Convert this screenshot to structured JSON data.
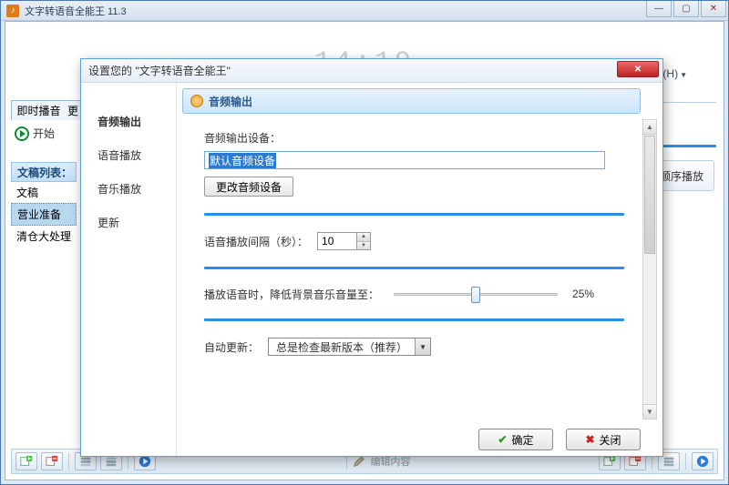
{
  "window": {
    "title": "文字转语音全能王 11.3",
    "clock": "14:19"
  },
  "menu_frag": {
    "help": "助(H)"
  },
  "left": {
    "tab_instant": "即时播音",
    "tab2_frag": "更",
    "start": "开始",
    "doclist_header": "文稿列表：",
    "items": [
      "文稿",
      "营业准备",
      "清仓大处理"
    ]
  },
  "right": {
    "seq_play": "顺序播放"
  },
  "toolbar": {
    "edit_placeholder": "编辑内容"
  },
  "dialog": {
    "title": "设置您的 \"文字转语音全能王\"",
    "nav": [
      "音频输出",
      "语音播放",
      "音乐播放",
      "更新"
    ],
    "section_title": "音频输出",
    "device_label": "音频输出设备：",
    "device_value": "默认音频设备",
    "change_device_btn": "更改音频设备",
    "interval_label": "语音播放间隔（秒）：",
    "interval_value": "10",
    "volume_label": "播放语音时，降低背景音乐音量至：",
    "volume_percent": "25%",
    "volume_pos": 0.5,
    "auto_update_label": "自动更新：",
    "auto_update_value": "总是检查最新版本（推荐）",
    "ok": "确定",
    "close": "关闭"
  }
}
